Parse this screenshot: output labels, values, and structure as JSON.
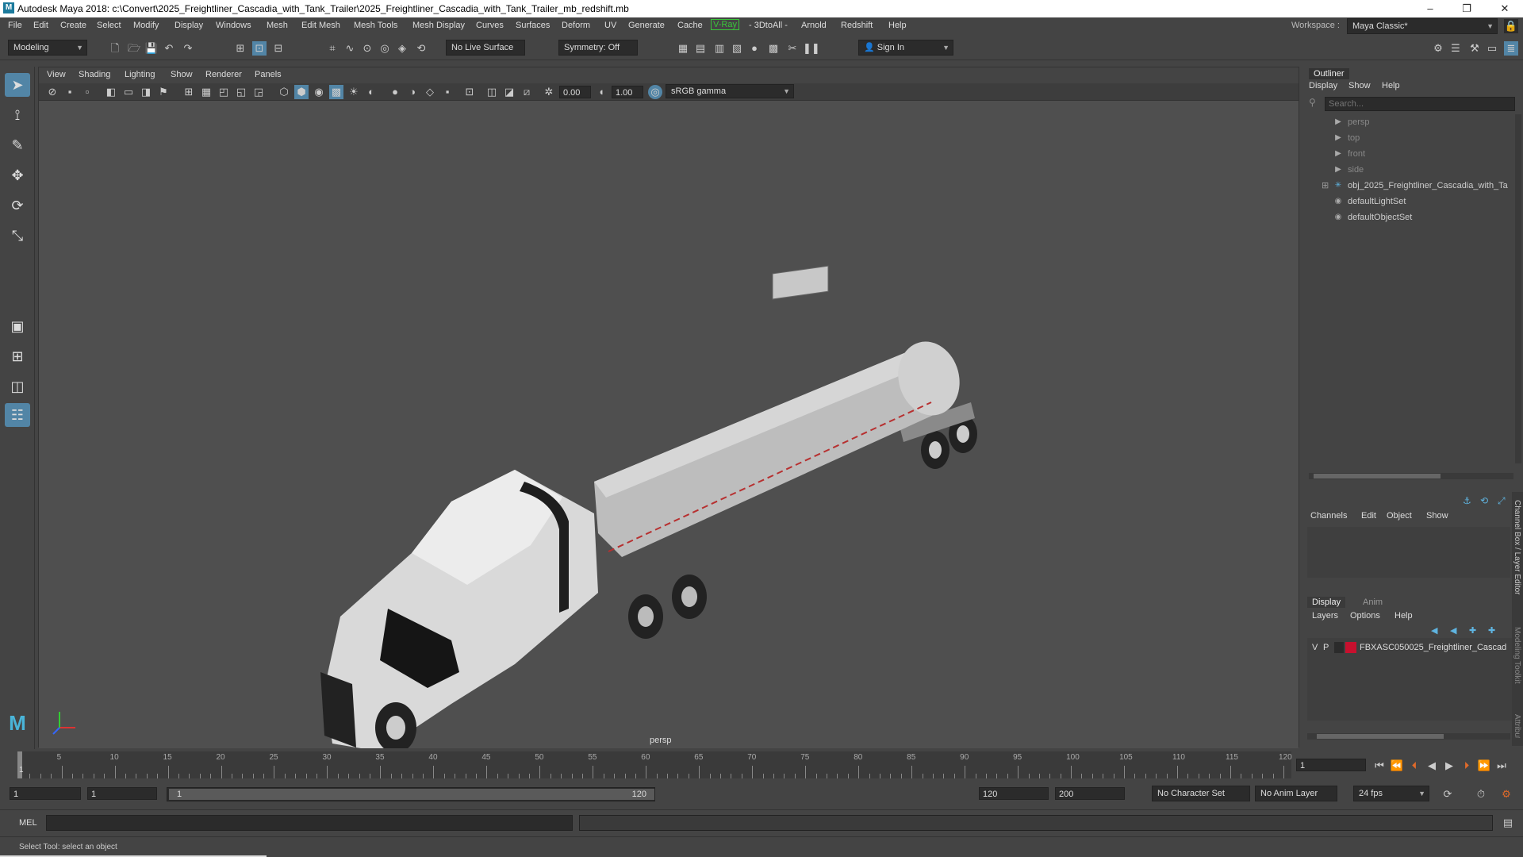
{
  "window": {
    "title": "Autodesk Maya 2018: c:\\Convert\\2025_Freightliner_Cascadia_with_Tank_Trailer\\2025_Freightliner_Cascadia_with_Tank_Trailer_mb_redshift.mb",
    "minimize": "–",
    "maximize": "❐",
    "close": "✕"
  },
  "menubar": {
    "items": [
      "File",
      "Edit",
      "Create",
      "Select",
      "Modify",
      "Display",
      "Windows",
      "Mesh",
      "Edit Mesh",
      "Mesh Tools",
      "Mesh Display",
      "Curves",
      "Surfaces",
      "Deform",
      "UV",
      "Generate",
      "Cache",
      "V-Ray",
      "- 3DtoAll -",
      "Arnold",
      "Redshift",
      "Help"
    ],
    "workspace_label": "Workspace :",
    "workspace_value": "Maya Classic*"
  },
  "shelf": {
    "mode": "Modeling",
    "live_surface": "No Live Surface",
    "symmetry": "Symmetry: Off",
    "sign_in": "Sign In"
  },
  "viewport": {
    "menus": [
      "View",
      "Shading",
      "Lighting",
      "Show",
      "Renderer",
      "Panels"
    ],
    "exposure": "0.00",
    "gamma": "1.00",
    "color_space": "sRGB gamma",
    "camera_label": "persp"
  },
  "outliner": {
    "title": "Outliner",
    "menus": [
      "Display",
      "Show",
      "Help"
    ],
    "search_placeholder": "Search...",
    "items": [
      {
        "label": "persp",
        "icon": "camera-icon",
        "dim": true
      },
      {
        "label": "top",
        "icon": "camera-icon",
        "dim": true
      },
      {
        "label": "front",
        "icon": "camera-icon",
        "dim": true
      },
      {
        "label": "side",
        "icon": "camera-icon",
        "dim": true
      },
      {
        "label": "obj_2025_Freightliner_Cascadia_with_Ta",
        "icon": "transform-icon",
        "dim": false
      },
      {
        "label": "defaultLightSet",
        "icon": "set-icon",
        "dim": false
      },
      {
        "label": "defaultObjectSet",
        "icon": "set-icon",
        "dim": false
      }
    ]
  },
  "channel_box": {
    "menus": [
      "Channels",
      "Edit",
      "Object",
      "Show"
    ],
    "side_tab": "Channel Box / Layer Editor",
    "side_tab2": "Modeling Toolkit",
    "side_tab3": "Attribute Editor"
  },
  "layer_editor": {
    "tabs": [
      "Display",
      "Anim"
    ],
    "menus": [
      "Layers",
      "Options",
      "Help"
    ],
    "layer": {
      "v": "V",
      "p": "P",
      "name": "FBXASC050025_Freightliner_Cascad",
      "color": "#c8102e"
    }
  },
  "timeline": {
    "ticks": [
      "5",
      "10",
      "15",
      "20",
      "25",
      "30",
      "35",
      "40",
      "45",
      "50",
      "55",
      "60",
      "65",
      "70",
      "75",
      "80",
      "85",
      "90",
      "95",
      "100",
      "105",
      "110",
      "115",
      "120"
    ],
    "start_marker": "1",
    "current_frame": "1"
  },
  "range": {
    "start": "1",
    "playback_start": "1",
    "slider_start": "1",
    "slider_end": "120",
    "playback_end": "120",
    "end": "200",
    "character_set": "No Character Set",
    "anim_layer": "No Anim Layer",
    "fps": "24 fps"
  },
  "command_line": {
    "label": "MEL"
  },
  "help_line": {
    "text": "Select Tool: select an object"
  },
  "colors": {
    "accent": "#5285a6",
    "vray": "#3ac43a",
    "layer_color": "#c8102e"
  }
}
